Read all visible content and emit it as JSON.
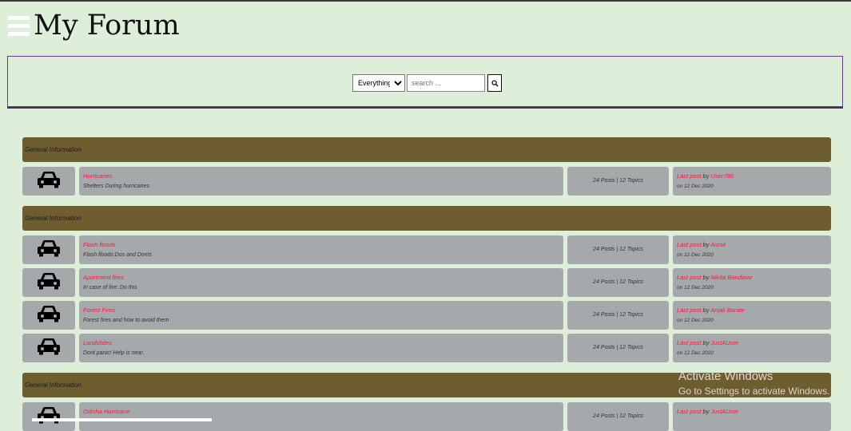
{
  "header": {
    "title": "My Forum",
    "menu_icon": "hamburger-menu-icon"
  },
  "search": {
    "scope_selected": "Everything",
    "scope_options": [
      "Everything"
    ],
    "placeholder": "search ...",
    "button_icon": "search-icon"
  },
  "sections": [
    {
      "title": "General Information",
      "topics": [
        {
          "icon": "car-icon",
          "title": "Hurricanes",
          "description": "Shelters During hurricanes",
          "stats": "24 Posts | 12 Topics",
          "last_post_label": "Last post",
          "by_label": "by",
          "last_user": "User786",
          "date": "on 12 Dec 2020"
        }
      ]
    },
    {
      "title": "General Information",
      "topics": [
        {
          "icon": "car-icon",
          "title": "Flash floods",
          "description": "Flash floods:Dos and Donts",
          "stats": "24 Posts | 12 Topics",
          "last_post_label": "Last post",
          "by_label": "by",
          "last_user": "Asmit",
          "date": "on 12 Dec 2020"
        },
        {
          "icon": "car-icon",
          "title": "Apartment fires",
          "description": "In case of fire: Do this",
          "stats": "24 Posts | 12 Topics",
          "last_post_label": "Last post",
          "by_label": "by",
          "last_user": "Nikita Bandiwar",
          "date": "on 12 Dec 2020"
        },
        {
          "icon": "car-icon",
          "title": "Forest Fires",
          "description": "Forest fires and how to avoid them",
          "stats": "24 Posts | 12 Topics",
          "last_post_label": "Last post",
          "by_label": "by",
          "last_user": "Anjali Borate",
          "date": "on 12 Dec 2020"
        },
        {
          "icon": "car-icon",
          "title": "Landslides",
          "description": "Dont panic! Help is near.",
          "stats": "24 Posts | 12 Topics",
          "last_post_label": "Last post",
          "by_label": "by",
          "last_user": "JustAUser",
          "date": "on 12 Dec 2020"
        }
      ]
    },
    {
      "title": "General Information",
      "topics": [
        {
          "icon": "car-icon",
          "title": "Odisha Hurricane",
          "description": "",
          "stats": "24 Posts | 12 Topics",
          "last_post_label": "Last post",
          "by_label": "by",
          "last_user": "JustAUser",
          "date": ""
        }
      ]
    }
  ],
  "watermark": {
    "line1": "Activate Windows",
    "line2": "Go to Settings to activate Windows."
  },
  "colors": {
    "background": "#ddeed9",
    "section_header": "#6e5e2f",
    "row_cell": "#a5a9ab",
    "link": "#ff1640",
    "search_border": "#6c3b8a"
  }
}
